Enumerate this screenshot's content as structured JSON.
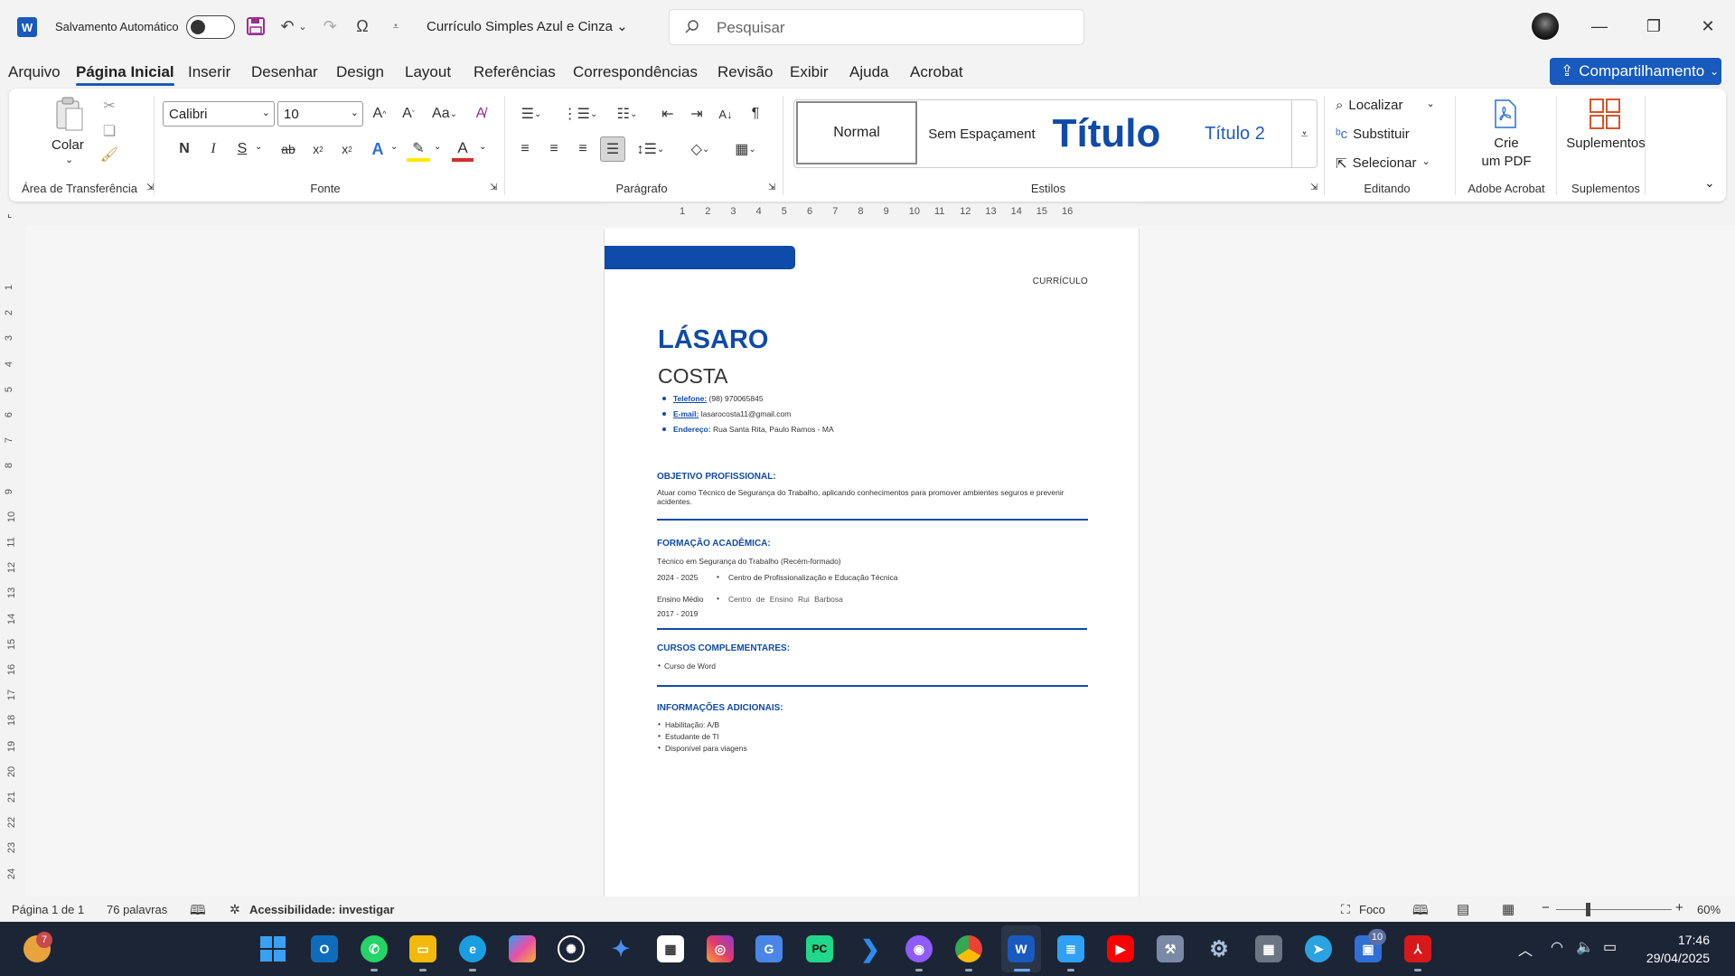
{
  "titlebar": {
    "autosave_label": "Salvamento Automático",
    "doc_title": "Currículo Simples Azul e Cinza",
    "search_placeholder": "Pesquisar",
    "app_logo": "W"
  },
  "tabs": [
    "Arquivo",
    "Página Inicial",
    "Inserir",
    "Desenhar",
    "Design",
    "Layout",
    "Referências",
    "Correspondências",
    "Revisão",
    "Exibir",
    "Ajuda",
    "Acrobat"
  ],
  "share_label": "Compartilhamento",
  "ribbon": {
    "paste_label": "Colar",
    "clipboard_label": "Área de Transferência",
    "font_label": "Fonte",
    "font_name": "Calibri",
    "font_size": "10",
    "paragraph_label": "Parágrafo",
    "styles_label": "Estilos",
    "styles": [
      "Normal",
      "Sem Espaçament",
      "Título",
      "Título 2"
    ],
    "editing_label": "Editando",
    "find_label": "Localizar",
    "replace_label": "Substituir",
    "select_label": "Selecionar",
    "acrobat_group_label": "Adobe Acrobat",
    "create_pdf_label_1": "Crie",
    "create_pdf_label_2": "um PDF",
    "addins_label": "Suplementos",
    "addins_group_label": "Suplementos",
    "bold": "N",
    "italic": "I",
    "underline": "S",
    "strike": "ab",
    "change_case": "Aa"
  },
  "document": {
    "header_label": "CURRÍCULO",
    "first_name": "LÁSARO",
    "last_name": "COSTA",
    "phone_label": "Telefone:",
    "phone_value": "(98) 970065845",
    "email_label": "E-mail:",
    "email_value": "lasarocosta11@gmail.com",
    "address_label": "Endereço:",
    "address_value": "Rua Santa Rita, Paulo Ramos - MA",
    "objective_title": "OBJETIVO PROFISSIONAL:",
    "objective_text_1": "Atuar como Técnico de Segurança do Trabalho, aplicando conhecimentos para promover ambientes seguros e prevenir",
    "objective_text_2": "acidentes.",
    "education_title": "FORMAÇÃO ACADÊMICA:",
    "edu1_course": "Técnico em Segurança do Trabalho (Recém-formado)",
    "edu1_years": "2024 - 2025",
    "edu1_school": "Centro de Profissionalização e Educação Técnica",
    "edu2_course": "Ensino Médio",
    "edu2_school": "Centro de Ensino Rui Barbosa",
    "edu2_years": "2017 - 2019",
    "courses_title": "CURSOS COMPLEMENTARES:",
    "courses": [
      "Curso de Word"
    ],
    "additional_title": "INFORMAÇÕES ADICIONAIS:",
    "additional": [
      "Habilitação: A/B",
      "Estudante de TI",
      "Disponível para viagens"
    ]
  },
  "ruler_numbers": [
    "1",
    "2",
    "3",
    "4",
    "5",
    "6",
    "7",
    "8",
    "9",
    "10",
    "11",
    "12",
    "13",
    "14",
    "15",
    "16"
  ],
  "vruler_numbers": [
    "1",
    "2",
    "3",
    "4",
    "5",
    "6",
    "7",
    "8",
    "9",
    "10",
    "11",
    "12",
    "13",
    "14",
    "15",
    "16",
    "17",
    "18",
    "19",
    "20",
    "21",
    "22",
    "23",
    "24"
  ],
  "status": {
    "page": "Página 1 de 1",
    "words": "76 palavras",
    "accessibility": "Acessibilidade: investigar",
    "focus": "Foco",
    "zoom": "60%"
  },
  "taskbar": {
    "time": "17:46",
    "date": "29/04/2025",
    "weather_badge": "7",
    "app_badge": "10"
  },
  "colors": {
    "accent": "#185abd",
    "resume_blue": "#0f4ba8",
    "taskbar": "#1c2535"
  }
}
